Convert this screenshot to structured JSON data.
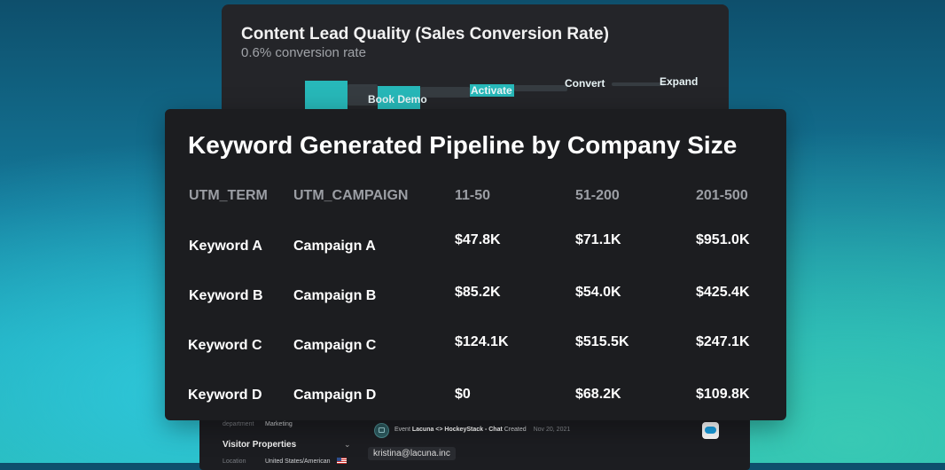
{
  "funnel_card": {
    "title": "Content Lead Quality (Sales Conversion Rate)",
    "subtitle": "0.6% conversion rate",
    "stages": [
      "Book Demo",
      "Activate",
      "Convert",
      "Expand"
    ],
    "accent_color": "#27b8b9"
  },
  "main_card": {
    "title": "Keyword Generated Pipeline by Company Size",
    "columns": [
      "UTM_TERM",
      "UTM_CAMPAIGN",
      "11-50",
      "51-200",
      "201-500"
    ],
    "rows": [
      [
        "Keyword A",
        "Campaign A",
        "$47.8K",
        "$71.1K",
        "$951.0K"
      ],
      [
        "Keyword B",
        "Campaign B",
        "$85.2K",
        "$54.0K",
        "$425.4K"
      ],
      [
        "Keyword C",
        "Campaign C",
        "$124.1K",
        "$515.5K",
        "$247.1K"
      ],
      [
        "Keyword D",
        "Campaign D",
        "$0",
        "$68.2K",
        "$109.8K"
      ]
    ]
  },
  "bottom_panel": {
    "department_label": "department",
    "department_value": "Marketing",
    "visitor_properties_heading": "Visitor Properties",
    "location_label": "Location",
    "location_value": "United States/American",
    "event_prefix": "Event",
    "event_name": "Lacuna <> HockeyStack - Chat",
    "event_suffix": "Created",
    "event_date": "Nov 20, 2021",
    "email": "kristina@lacuna.inc",
    "crm_icon": "salesforce-cloud-icon",
    "flag_icon": "us-flag-icon"
  }
}
